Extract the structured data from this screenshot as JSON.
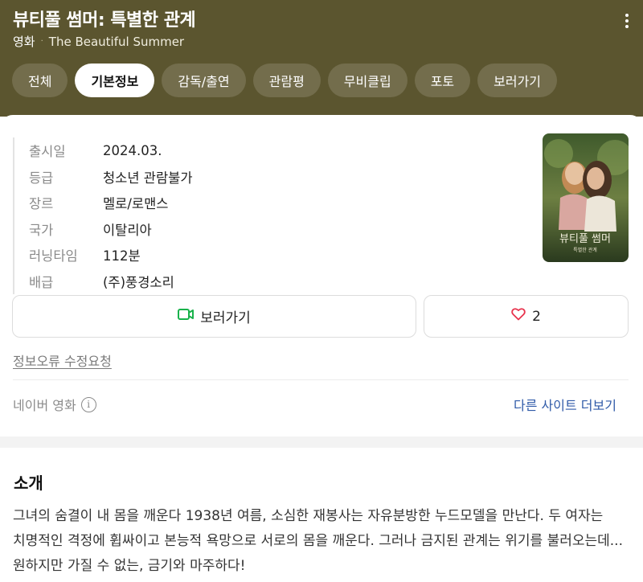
{
  "header": {
    "title": "뷰티풀 썸머: 특별한 관계",
    "type_label": "영화",
    "dot": "·",
    "original_title": "The Beautiful Summer",
    "accent_color": "#5b552f"
  },
  "tabs": [
    {
      "label": "전체",
      "active": false
    },
    {
      "label": "기본정보",
      "active": true
    },
    {
      "label": "감독/출연",
      "active": false
    },
    {
      "label": "관람평",
      "active": false
    },
    {
      "label": "무비클립",
      "active": false
    },
    {
      "label": "포토",
      "active": false
    },
    {
      "label": "보러가기",
      "active": false
    }
  ],
  "info": [
    {
      "key": "출시일",
      "value": "2024.03."
    },
    {
      "key": "등급",
      "value": "청소년 관람불가"
    },
    {
      "key": "장르",
      "value": "멜로/로맨스"
    },
    {
      "key": "국가",
      "value": "이탈리아"
    },
    {
      "key": "러닝타임",
      "value": "112분"
    },
    {
      "key": "배급",
      "value": "(주)풍경소리"
    }
  ],
  "poster": {
    "title_text": "뷰티풀 썸머",
    "sub_text": "특별한 관계"
  },
  "actions": {
    "watch_label": "보러가기",
    "watch_icon": "video-icon",
    "like_count": "2",
    "like_icon": "heart-icon"
  },
  "links": {
    "fix_request": "정보오류 수정요청",
    "source": "네이버 영화",
    "other_sites": "다른 사이트 더보기"
  },
  "intro": {
    "title": "소개",
    "text": "그녀의 숨결이 내 몸을 깨운다 1938년 여름, 소심한 재봉사는 자유분방한 누드모델을 만난다. 두 여자는 치명적인 격정에 휩싸이고 본능적 욕망으로 서로의 몸을 깨운다. 그러나 금지된 관계는 위기를 불러오는데... 원하지만 가질 수 없는, 금기와 마주하다!"
  }
}
